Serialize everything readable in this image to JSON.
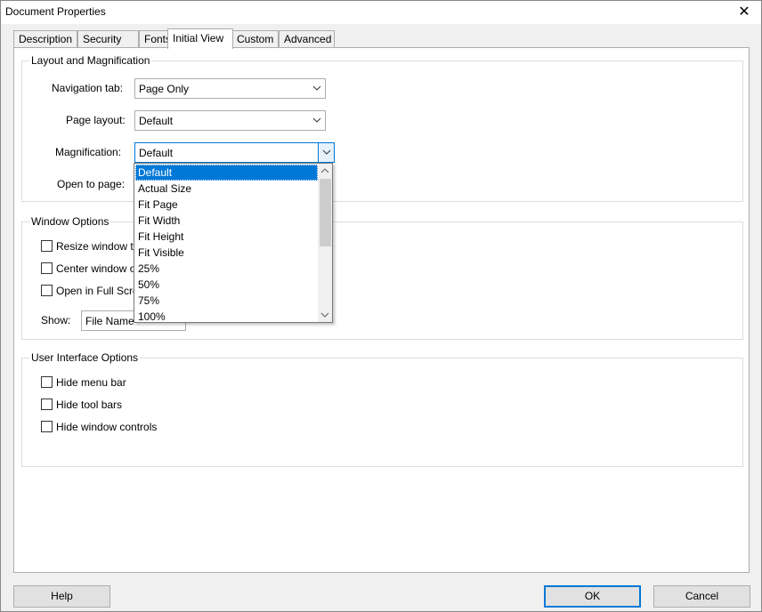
{
  "window": {
    "title": "Document Properties",
    "close_glyph": "✕"
  },
  "tabs": [
    {
      "label": "Description"
    },
    {
      "label": "Security"
    },
    {
      "label": "Fonts"
    },
    {
      "label": "Initial View",
      "active": true
    },
    {
      "label": "Custom"
    },
    {
      "label": "Advanced"
    }
  ],
  "layout_group": {
    "title": "Layout and Magnification",
    "navigation_tab_label": "Navigation tab:",
    "navigation_tab_value": "Page Only",
    "page_layout_label": "Page layout:",
    "page_layout_value": "Default",
    "magnification_label": "Magnification:",
    "magnification_value": "Default",
    "open_to_page_label": "Open to page:"
  },
  "magnification_dropdown": {
    "items": [
      "Default",
      "Actual Size",
      "Fit Page",
      "Fit Width",
      "Fit Height",
      "Fit Visible",
      "25%",
      "50%",
      "75%",
      "100%"
    ],
    "selected": "Default"
  },
  "window_group": {
    "title": "Window Options",
    "resize_label": "Resize window to",
    "center_label": "Center window o",
    "fullscreen_label": "Open in Full Scre",
    "show_label": "Show:",
    "show_value": "File Name"
  },
  "ui_group": {
    "title": "User Interface Options",
    "hide_menu_label": "Hide menu bar",
    "hide_toolbars_label": "Hide tool bars",
    "hide_window_controls_label": "Hide window controls"
  },
  "buttons": {
    "help": "Help",
    "ok": "OK",
    "cancel": "Cancel"
  },
  "colors": {
    "accent": "#0078d7",
    "panel": "#ffffff",
    "chrome": "#f0f0f0"
  },
  "icons": {
    "combo_arrow": "chevron-down-icon",
    "close": "close-icon"
  }
}
